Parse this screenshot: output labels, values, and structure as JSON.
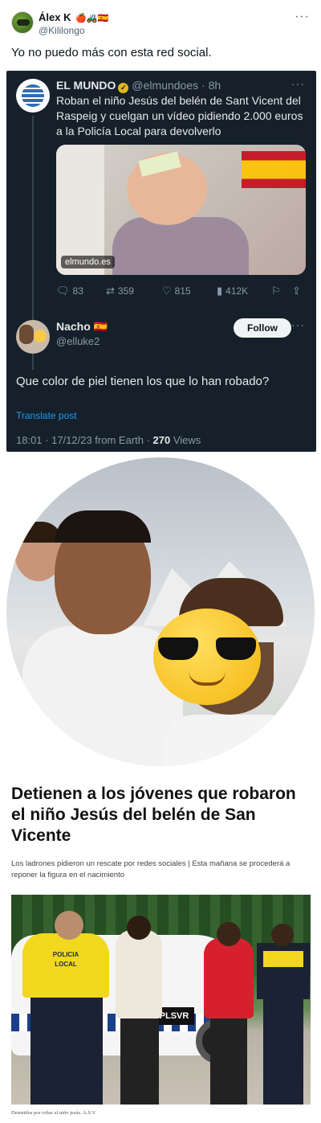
{
  "tweet": {
    "author_name": "Álex K",
    "author_emojis": "🍎🚜🇪🇸",
    "author_handle": "@Kililongo",
    "more": "···",
    "text": "Yo no puedo más con esta red social."
  },
  "quoted": {
    "author_name": "EL MUNDO",
    "author_handle": "@elmundoes · 8h",
    "verified_icon": "verified-gold-icon",
    "more": "···",
    "text": "Roban el niño Jesús del belén de Sant Vicent del Raspeig y cuelgan un vídeo pidiendo 2.000 euros a la Policía Local para devolverlo",
    "media_source": "elmundo.es",
    "stats": {
      "replies": "83",
      "retweets": "359",
      "likes": "815",
      "views": "412K"
    }
  },
  "reply": {
    "author_name": "Nacho 🇪🇸",
    "author_handle": "@elluke2",
    "follow_label": "Follow",
    "more": "···",
    "text": "Que color de piel tienen los que lo han robado?",
    "translate_label": "Translate post",
    "meta_prefix": "18:01 · 17/12/23 from Earth · ",
    "views_count": "270",
    "views_label": " Views"
  },
  "article": {
    "headline": "Detienen a los jóvenes que robaron el niño Jesús del belén de San Vicente",
    "subhead": "Los ladrones pidieron un rescate por redes sociales | Esta mañana se procederá a reponer la figura en el nacimiento",
    "photo_vest_text_1": "POLICIA",
    "photo_vest_text_2": "LOCAL",
    "photo_plate": "PLSVR",
    "caption": "Detenidos por robar el niño jesús. A.S.V."
  },
  "colors": {
    "dark_bg": "#15202b",
    "link": "#1d9bf0",
    "muted": "#8b98a5"
  }
}
